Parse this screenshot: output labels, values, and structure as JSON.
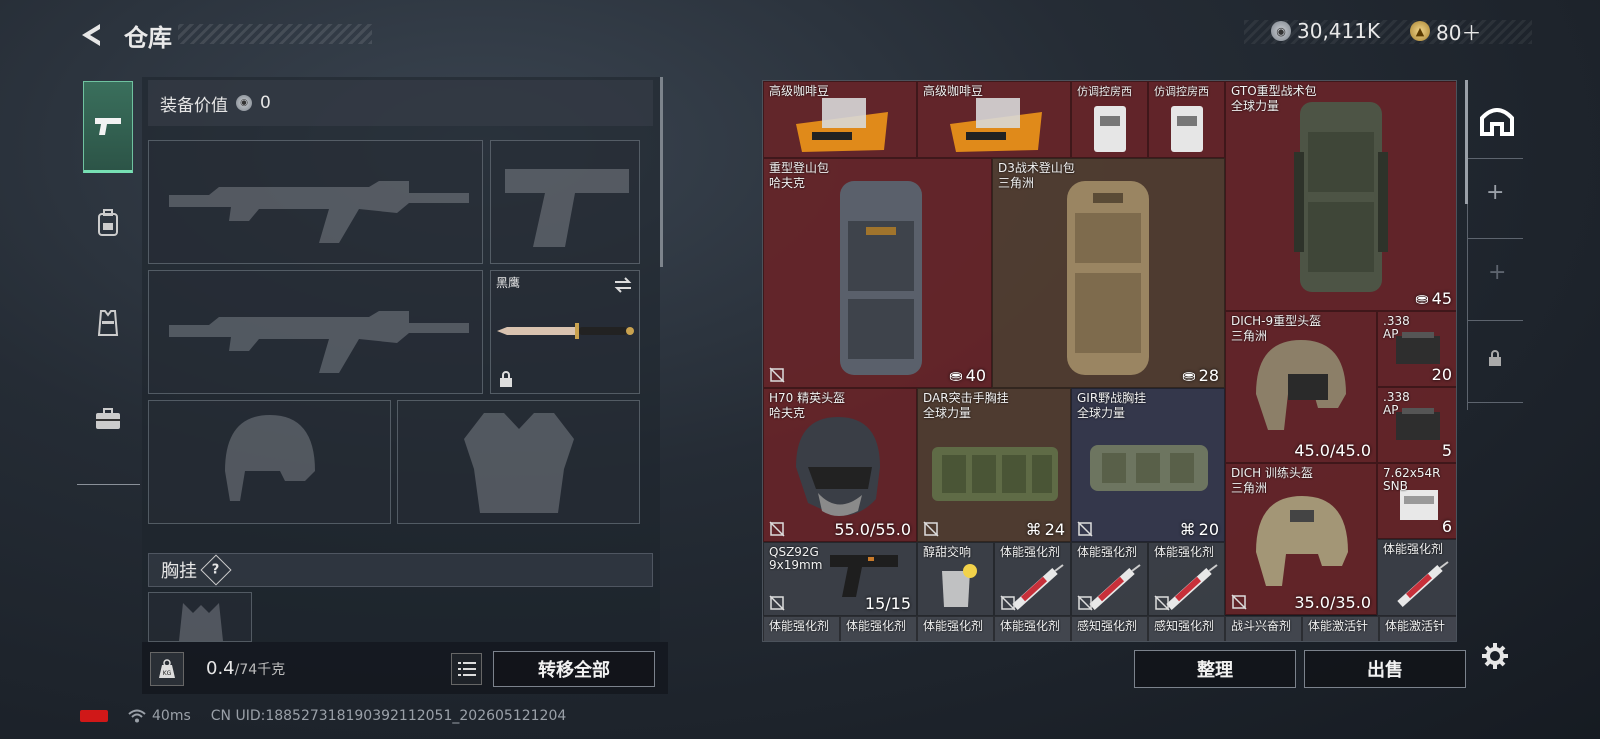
{
  "header": {
    "title": "仓库",
    "currencies": [
      {
        "icon": "silver-coin-icon",
        "value": "30,411K"
      },
      {
        "icon": "gold-coin-icon",
        "value": "80＋"
      }
    ]
  },
  "tabs": [
    {
      "icon": "pistol-icon",
      "active": true
    },
    {
      "icon": "backpack-icon",
      "active": false
    },
    {
      "icon": "vest-icon",
      "active": false
    },
    {
      "icon": "toolbox-icon",
      "active": false
    }
  ],
  "loadout": {
    "equip_value_label": "装备价值",
    "equip_value": "0",
    "knife_name": "黑鹰",
    "chest_rig_label": "胸挂",
    "chest_rig_help": "?",
    "weight_current": "0.4",
    "weight_max": "/74千克",
    "transfer_all": "转移全部"
  },
  "stash": {
    "items": [
      {
        "name": "高级咖啡豆",
        "sub": ""
      },
      {
        "name": "高级咖啡豆",
        "sub": ""
      },
      {
        "name": "仿调控房西",
        "sub": ""
      },
      {
        "name": "仿调控房西",
        "sub": ""
      },
      {
        "name": "GTO重型战术包",
        "sub": "全球力量",
        "count": "45"
      },
      {
        "name": "重型登山包",
        "sub": "哈夫克",
        "count": "40"
      },
      {
        "name": "D3战术登山包",
        "sub": "三角洲",
        "count": "28"
      },
      {
        "name": "DICH-9重型头盔",
        "sub": "三角洲",
        "count": "45.0/45.0"
      },
      {
        "name": ".338",
        "sub": "AP",
        "count": "20"
      },
      {
        "name": ".338",
        "sub": "AP",
        "count": "5"
      },
      {
        "name": "H70 精英头盔",
        "sub": "哈夫克",
        "count": "55.0/55.0"
      },
      {
        "name": "DAR突击手胸挂",
        "sub": "全球力量",
        "count": "24"
      },
      {
        "name": "GIR野战胸挂",
        "sub": "全球力量",
        "count": "20"
      },
      {
        "name": "DICH 训练头盔",
        "sub": "三角洲",
        "count": "35.0/35.0"
      },
      {
        "name": "7.62x54R",
        "sub": "SNB",
        "count": "6"
      },
      {
        "name": "QSZ92G",
        "sub": "9x19mm",
        "count": "15/15"
      },
      {
        "name": "醇甜交响",
        "sub": ""
      },
      {
        "name": "体能强化剂",
        "sub": ""
      },
      {
        "name": "体能强化剂",
        "sub": ""
      },
      {
        "name": "体能强化剂",
        "sub": ""
      },
      {
        "name": "体能强化剂",
        "sub": ""
      }
    ],
    "bottom_row": [
      "体能强化剂",
      "体能强化剂",
      "体能强化剂",
      "体能强化剂",
      "感知强化剂",
      "感知强化剂",
      "战斗兴奋剂",
      "体能激活针",
      "体能激活针"
    ],
    "sort_button": "整理",
    "sell_button": "出售"
  },
  "status": {
    "ping": "40ms",
    "uid": "CN UID:188527318190392112051_202605121204"
  }
}
